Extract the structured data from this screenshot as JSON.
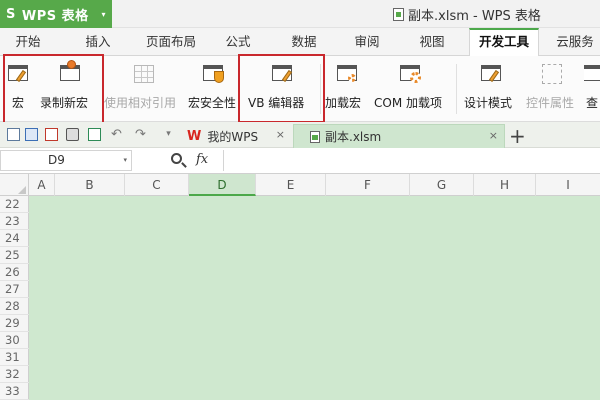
{
  "app": {
    "name": "WPS 表格",
    "window_title": "副本.xlsm - WPS 表格",
    "logo_letter": "S",
    "menu_arrow": "▾"
  },
  "menu_tabs": [
    {
      "label": "开始",
      "active": false
    },
    {
      "label": "插入",
      "active": false
    },
    {
      "label": "页面布局",
      "active": false
    },
    {
      "label": "公式",
      "active": false
    },
    {
      "label": "数据",
      "active": false
    },
    {
      "label": "审阅",
      "active": false
    },
    {
      "label": "视图",
      "active": false
    },
    {
      "label": "开发工具",
      "active": true
    },
    {
      "label": "云服务",
      "active": false
    }
  ],
  "ribbon": {
    "macro": "宏",
    "record_macro": "录制新宏",
    "relative_ref": "使用相对引用",
    "macro_security": "宏安全性",
    "vb_editor": "VB 编辑器",
    "load_macro": "加载宏",
    "com_addins": "COM 加载项",
    "design_mode": "设计模式",
    "control_props": "控件属性",
    "view_code": "查"
  },
  "quick_access": {
    "dropdown_glyph": "▾",
    "undo_glyph": "↶",
    "redo_glyph": "↷",
    "extra_glyph": "⌄"
  },
  "doc_tabs": [
    {
      "label": "我的WPS",
      "close": "×"
    },
    {
      "label": "副本.xlsm",
      "close": "×"
    }
  ],
  "new_tab": "+",
  "formula_bar": {
    "cell_ref": "D9",
    "fx": "fx",
    "content": ""
  },
  "columns": [
    "A",
    "B",
    "C",
    "D",
    "E",
    "F",
    "G",
    "H",
    "I"
  ],
  "selected_column": "D",
  "rows": [
    "22",
    "23",
    "24",
    "25",
    "26",
    "27",
    "28",
    "29",
    "30",
    "31",
    "32",
    "33"
  ],
  "colors": {
    "app_green": "#57a94a",
    "active_tab_border": "#4ca84a",
    "highlight_red": "#c9282d",
    "sheet_fill": "#cfe8cf",
    "selected_col": "#cfe6cf"
  }
}
